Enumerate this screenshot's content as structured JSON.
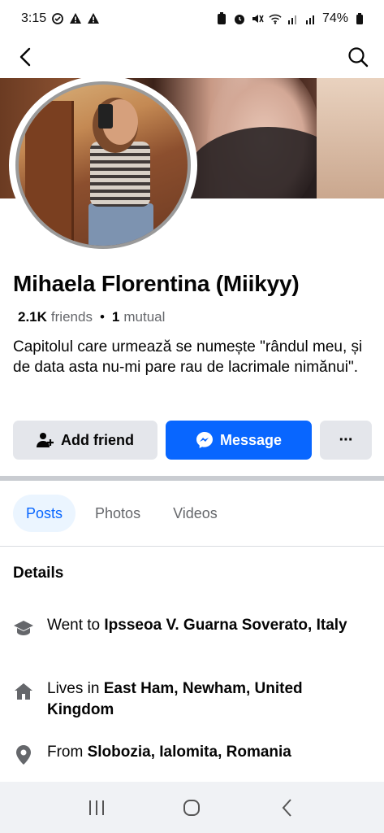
{
  "status_bar": {
    "time": "3:15",
    "battery": "74%",
    "left_icons": [
      "sync-icon",
      "alert-icon",
      "alert-icon"
    ],
    "right_icons": [
      "battery-saver-icon",
      "alarm-icon",
      "mute-icon",
      "wifi-icon",
      "signal-icon",
      "signal-icon",
      "battery-icon"
    ]
  },
  "profile": {
    "name": "Mihaela Florentina (Miikyy)",
    "friends_count": "2.1K",
    "friends_label": "friends",
    "separator": "•",
    "mutual_count": "1",
    "mutual_label": "mutual",
    "bio": "Capitolul care urmează se numește \"rândul meu, și de data asta nu-mi pare rau de lacrimale nimănui\"."
  },
  "actions": {
    "add_friend": "Add friend",
    "message": "Message",
    "more": "···"
  },
  "tabs": [
    {
      "label": "Posts",
      "active": true
    },
    {
      "label": "Photos",
      "active": false
    },
    {
      "label": "Videos",
      "active": false
    }
  ],
  "details": {
    "title": "Details",
    "items": [
      {
        "icon": "education-cap-icon",
        "prefix": "Went to ",
        "value": "Ipsseoa V. Guarna Soverato, Italy"
      },
      {
        "icon": "home-icon",
        "prefix": "Lives in ",
        "value": "East Ham, Newham, United Kingdom"
      },
      {
        "icon": "location-pin-icon",
        "prefix": "From ",
        "value": "Slobozia, Ialomita, Romania"
      }
    ]
  },
  "colors": {
    "accent": "#0866ff",
    "button_gray": "#e4e6eb",
    "tab_active_bg": "#ebf5ff",
    "secondary_text": "#65676b"
  }
}
